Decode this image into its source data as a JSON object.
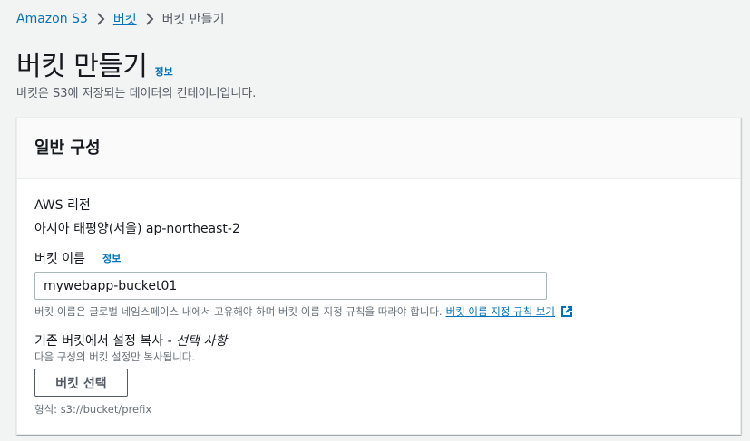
{
  "breadcrumb": {
    "items": [
      "Amazon S3",
      "버킷",
      "버킷 만들기"
    ]
  },
  "header": {
    "title": "버킷 만들기",
    "info": "정보",
    "subtitle": "버킷은 S3에 저장되는 데이터의 컨테이너입니다."
  },
  "general": {
    "title": "일반 구성",
    "region_label": "AWS 리전",
    "region_value": "아시아 태평양(서울) ap-northeast-2",
    "name_label": "버킷 이름",
    "name_info": "정보",
    "name_value": "mywebapp-bucket01",
    "name_hint": "버킷 이름은 글로벌 네임스페이스 내에서 고유해야 하며 버킷 이름 지정 규칙을 따라야 합니다.",
    "name_rules_link": "버킷 이름 지정 규칙 보기",
    "copy_label": "기존 버킷에서 설정 복사",
    "copy_optional": "선택 사항",
    "copy_desc": "다음 구성의 버킷 설정만 복사됩니다.",
    "choose_button": "버킷 선택",
    "format": "형식: s3://bucket/prefix"
  },
  "icons": {
    "separator": "chevron-right-icon",
    "external": "external-link-icon"
  },
  "colors": {
    "link": "#0073bb",
    "text": "#16191f",
    "muted": "#687078"
  }
}
